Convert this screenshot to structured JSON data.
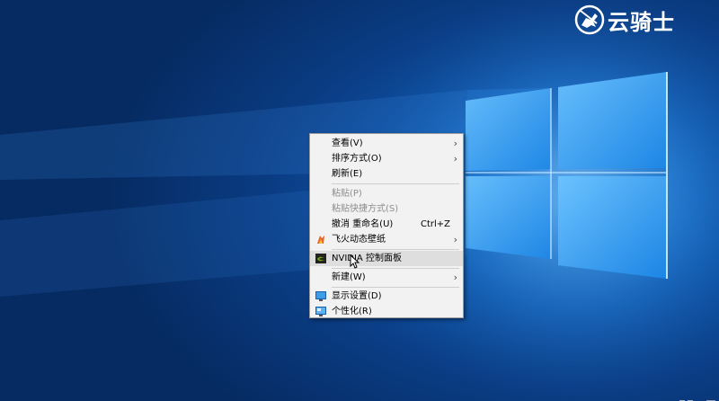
{
  "watermark": {
    "text": "云骑士",
    "logo_icon": "knight-on-horse-logo"
  },
  "menu": {
    "items": [
      {
        "id": "view",
        "label": "查看(V)",
        "submenu": true,
        "disabled": false
      },
      {
        "id": "sort",
        "label": "排序方式(O)",
        "submenu": true,
        "disabled": false
      },
      {
        "id": "refresh",
        "label": "刷新(E)",
        "submenu": false,
        "disabled": false
      },
      {
        "id": "paste",
        "label": "粘贴(P)",
        "submenu": false,
        "disabled": true
      },
      {
        "id": "paste-shortcut",
        "label": "粘贴快捷方式(S)",
        "submenu": false,
        "disabled": true
      },
      {
        "id": "undo-rename",
        "label": "撤消 重命名(U)",
        "shortcut": "Ctrl+Z",
        "submenu": false,
        "disabled": false
      },
      {
        "id": "feihuo-wallpaper",
        "label": "飞火动态壁纸",
        "submenu": true,
        "disabled": false,
        "icon": "feihuo-wallpaper-icon"
      },
      {
        "id": "nvidia",
        "label": "NVIDIA 控制面板",
        "submenu": false,
        "disabled": false,
        "highlighted": true,
        "icon": "nvidia-icon"
      },
      {
        "id": "new",
        "label": "新建(W)",
        "submenu": true,
        "disabled": false
      },
      {
        "id": "display-settings",
        "label": "显示设置(D)",
        "submenu": false,
        "disabled": false,
        "icon": "display-settings-icon"
      },
      {
        "id": "personalize",
        "label": "个性化(R)",
        "submenu": false,
        "disabled": false,
        "icon": "personalize-icon"
      }
    ]
  },
  "colors": {
    "menu_bg": "#f2f2f2",
    "highlight": "#dedede",
    "disabled_text": "#8d8d8d",
    "wallpaper_blue": "#0f56ab"
  }
}
